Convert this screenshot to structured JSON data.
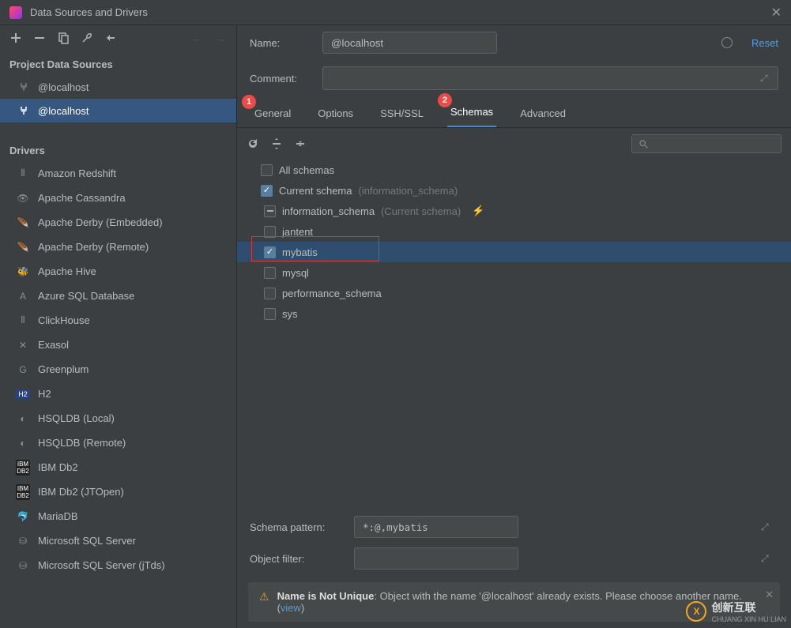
{
  "window": {
    "title": "Data Sources and Drivers"
  },
  "sidebar": {
    "section1": "Project Data Sources",
    "data_sources": [
      {
        "label": "@localhost",
        "selected": false
      },
      {
        "label": "@localhost",
        "selected": true
      }
    ],
    "section2": "Drivers",
    "drivers": [
      "Amazon Redshift",
      "Apache Cassandra",
      "Apache Derby (Embedded)",
      "Apache Derby (Remote)",
      "Apache Hive",
      "Azure SQL Database",
      "ClickHouse",
      "Exasol",
      "Greenplum",
      "H2",
      "HSQLDB (Local)",
      "HSQLDB (Remote)",
      "IBM Db2",
      "IBM Db2 (JTOpen)",
      "MariaDB",
      "Microsoft SQL Server",
      "Microsoft SQL Server (jTds)"
    ]
  },
  "form": {
    "name_label": "Name:",
    "name_value": "@localhost",
    "reset": "Reset",
    "comment_label": "Comment:"
  },
  "tabs": {
    "items": [
      {
        "label": "General",
        "badge": "1"
      },
      {
        "label": "Options"
      },
      {
        "label": "SSH/SSL"
      },
      {
        "label": "Schemas",
        "badge": "2",
        "active": true
      },
      {
        "label": "Advanced"
      }
    ]
  },
  "tree": {
    "all_schemas": "All schemas",
    "current_schema_label": "Current schema",
    "current_schema_hint": "(information_schema)",
    "info_schema": "information_schema",
    "info_schema_hint": "(Current schema)",
    "rows": [
      "jantent",
      "mybatis",
      "mysql",
      "performance_schema",
      "sys"
    ]
  },
  "bottom": {
    "pattern_label": "Schema pattern:",
    "pattern_value": "*:@,mybatis",
    "filter_label": "Object filter:"
  },
  "warning": {
    "title": "Name is Not Unique",
    "body": ": Object with the name '@localhost' already exists.  Please choose another name. (",
    "view": "view",
    "close_paren": ")"
  },
  "watermark": {
    "cn": "创新互联",
    "en": "CHUANG XIN HU LIAN"
  }
}
